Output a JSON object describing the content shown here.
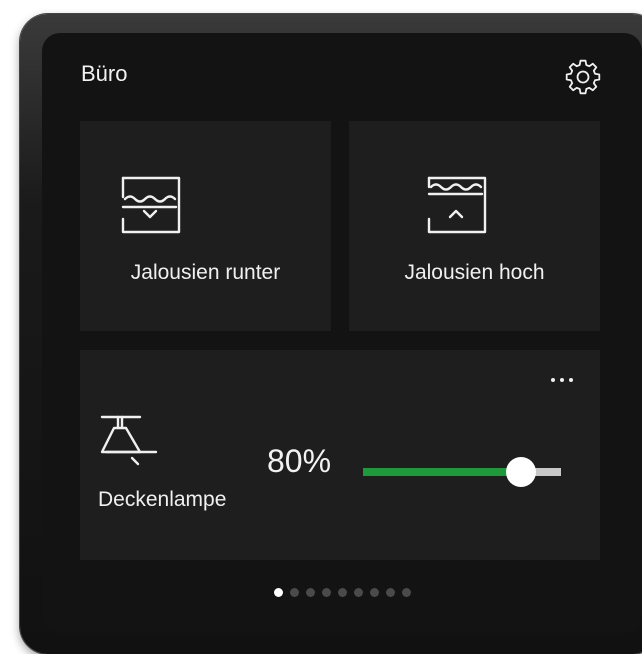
{
  "header": {
    "room_title": "Büro",
    "settings_icon": "gear-icon"
  },
  "tiles": [
    {
      "label": "Jalousien runter",
      "icon": "blinds-down-icon"
    },
    {
      "label": "Jalousien hoch",
      "icon": "blinds-up-icon"
    }
  ],
  "lamp": {
    "label": "Deckenlampe",
    "icon": "ceiling-lamp-icon",
    "brightness_text": "80%",
    "brightness_value": 0.8,
    "more_icon": "more-icon",
    "colors": {
      "fill": "#1f9a3a",
      "track": "#c8c8c8",
      "thumb": "#ffffff"
    }
  },
  "pager": {
    "page_count": 9,
    "active_index": 0
  }
}
